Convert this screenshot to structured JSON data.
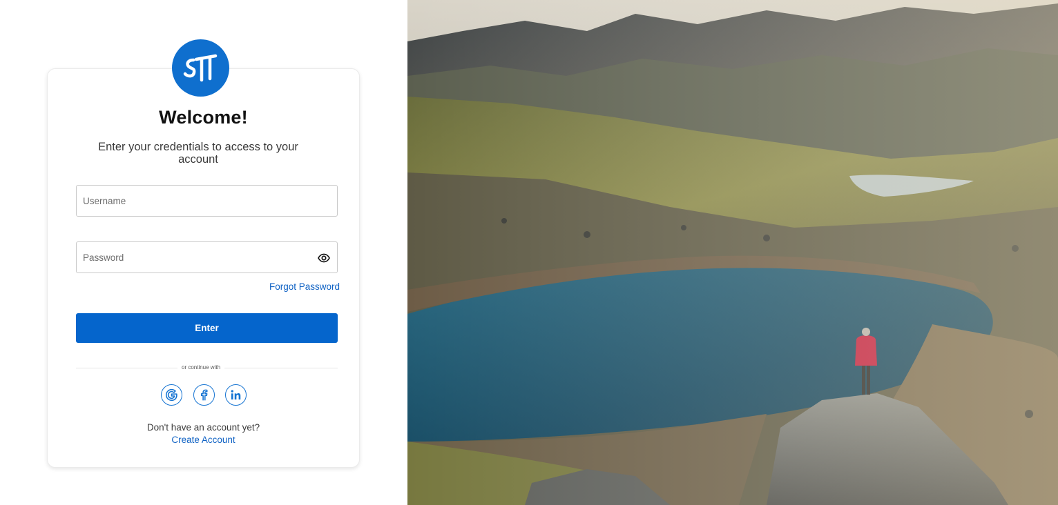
{
  "login": {
    "title": "Welcome!",
    "subtitle": "Enter your credentials to access to your account",
    "username": {
      "placeholder": "Username",
      "value": ""
    },
    "password": {
      "placeholder": "Password",
      "value": ""
    },
    "forgot_password": "Forgot Password",
    "enter_button": "Enter",
    "divider_text": "or continue with",
    "social": [
      {
        "name": "Google",
        "icon": "google-icon"
      },
      {
        "name": "Facebook",
        "icon": "facebook-icon"
      },
      {
        "name": "LinkedIn",
        "icon": "linkedin-icon"
      }
    ],
    "no_account_text": "Don't have an account yet?",
    "create_account": "Create Account"
  },
  "logo": {
    "icon": "brand-logo-icon",
    "color": "#0F6FCE"
  },
  "colors": {
    "primary": "#0565CC",
    "link": "#0F62C4",
    "icon_outline": "#1473D2"
  },
  "hero_image": {
    "description_icon": "mountain-lake-landscape-photo"
  }
}
